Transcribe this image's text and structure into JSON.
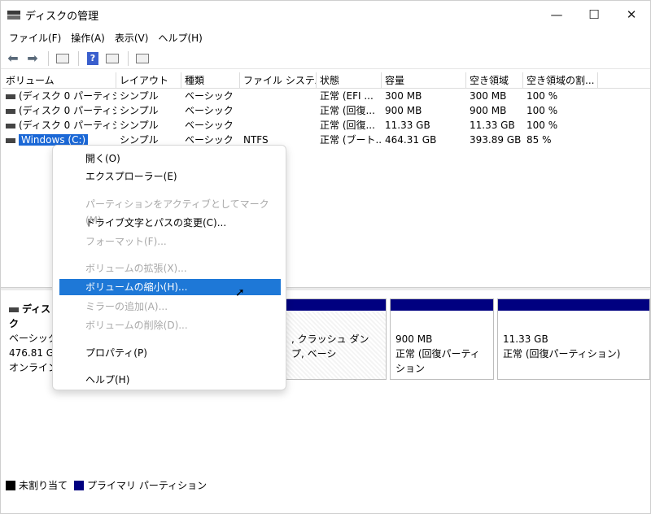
{
  "window": {
    "title": "ディスクの管理",
    "minimize_glyph": "—",
    "maximize_glyph": "☐",
    "close_glyph": "✕"
  },
  "menu": [
    "ファイル(F)",
    "操作(A)",
    "表示(V)",
    "ヘルプ(H)"
  ],
  "toolbar": {
    "icons": [
      "back-arrow-icon",
      "forward-arrow-icon",
      "volume-list-icon",
      "help-icon",
      "properties-icon",
      "console-icon"
    ]
  },
  "columns": [
    "ボリューム",
    "レイアウト",
    "種類",
    "ファイル システム",
    "状態",
    "容量",
    "空き領域",
    "空き領域の割..."
  ],
  "rows": [
    [
      "(ディスク 0 パーティショ...",
      "シンプル",
      "ベーシック",
      "",
      "正常 (EFI ...",
      "300 MB",
      "300 MB",
      "100 %"
    ],
    [
      "(ディスク 0 パーティショ...",
      "シンプル",
      "ベーシック",
      "",
      "正常 (回復...",
      "900 MB",
      "900 MB",
      "100 %"
    ],
    [
      "(ディスク 0 パーティショ...",
      "シンプル",
      "ベーシック",
      "",
      "正常 (回復...",
      "11.33 GB",
      "11.33 GB",
      "100 %"
    ],
    [
      "Windows (C:)",
      "シンプル",
      "ベーシック",
      "NTFS",
      "正常 (ブート...",
      "464.31 GB",
      "393.89 GB",
      "85 %"
    ]
  ],
  "disk": {
    "name": "ディスク",
    "type": "ベーシック",
    "size": "476.81 GI",
    "status": "オンライン"
  },
  "partitions": [
    {
      "size": "",
      "status": ", クラッシュ ダンプ, ベーシ"
    },
    {
      "size": "900 MB",
      "status": "正常 (回復パーティション"
    },
    {
      "size": "11.33 GB",
      "status": "正常 (回復パーティション)"
    }
  ],
  "legend": {
    "unallocated": "未割り当て",
    "primary": "プライマリ パーティション",
    "unallocated_color": "#000000",
    "primary_color": "#000080"
  },
  "context_menu": {
    "open": "開く(O)",
    "explorer": "エクスプローラー(E)",
    "mark_active": "パーティションをアクティブとしてマーク(M)",
    "change_letter": "ドライブ文字とパスの変更(C)...",
    "format": "フォーマット(F)...",
    "extend": "ボリュームの拡張(X)...",
    "shrink": "ボリュームの縮小(H)...",
    "add_mirror": "ミラーの追加(A)...",
    "delete": "ボリュームの削除(D)...",
    "properties": "プロパティ(P)",
    "help": "ヘルプ(H)"
  },
  "colors": {
    "selection": "#1b68d6",
    "partition_bar": "#000080"
  }
}
